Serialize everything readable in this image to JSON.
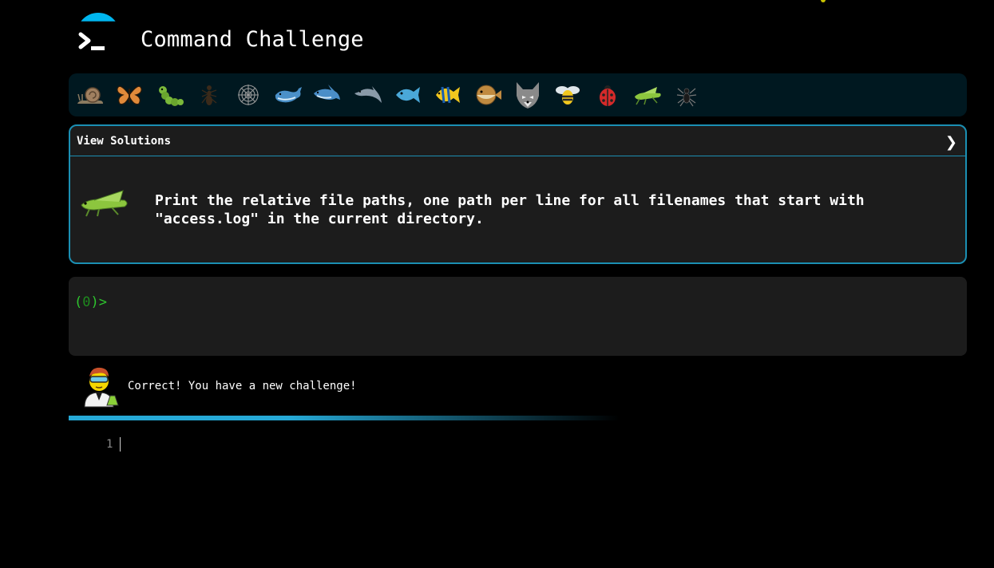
{
  "header": {
    "title": "Command Challenge",
    "logo_icon": "terminal-prompt-icon"
  },
  "emoji_bar": {
    "items": [
      {
        "name": "snail",
        "icon": "snail-icon"
      },
      {
        "name": "butterfly",
        "icon": "butterfly-icon"
      },
      {
        "name": "caterpillar",
        "icon": "caterpillar-icon"
      },
      {
        "name": "ant",
        "icon": "ant-icon"
      },
      {
        "name": "spider-web",
        "icon": "spider-web-icon"
      },
      {
        "name": "whale",
        "icon": "whale-icon"
      },
      {
        "name": "shark",
        "icon": "shark-icon"
      },
      {
        "name": "dolphin",
        "icon": "dolphin-icon"
      },
      {
        "name": "fish",
        "icon": "fish-icon"
      },
      {
        "name": "tropical-fish",
        "icon": "tropical-fish-icon"
      },
      {
        "name": "blowfish",
        "icon": "blowfish-icon"
      },
      {
        "name": "wolf",
        "icon": "wolf-icon"
      },
      {
        "name": "bee",
        "icon": "bee-icon"
      },
      {
        "name": "ladybug",
        "icon": "ladybug-icon"
      },
      {
        "name": "cricket",
        "icon": "cricket-icon"
      },
      {
        "name": "spider",
        "icon": "spider-icon"
      }
    ]
  },
  "challenge": {
    "view_solutions_label": "View Solutions",
    "chevron": "❯",
    "icon": "cricket-icon",
    "text": "Print the relative file paths, one path per line for all filenames that start with \"access.log\" in the current directory."
  },
  "terminal": {
    "prompt_open": "(",
    "prompt_count": "0",
    "prompt_close": ")>",
    "input_value": ""
  },
  "feedback": {
    "avatar_icon": "scientist-icon",
    "message": "Correct! You have a new challenge!",
    "progress_color": "#26a9d6"
  },
  "editor": {
    "line_number": "1",
    "content": ""
  },
  "colors": {
    "accent": "#00b6ef",
    "panel_border": "#1b8fb3",
    "prompt_green": "#2ec52e",
    "background": "#000000"
  }
}
